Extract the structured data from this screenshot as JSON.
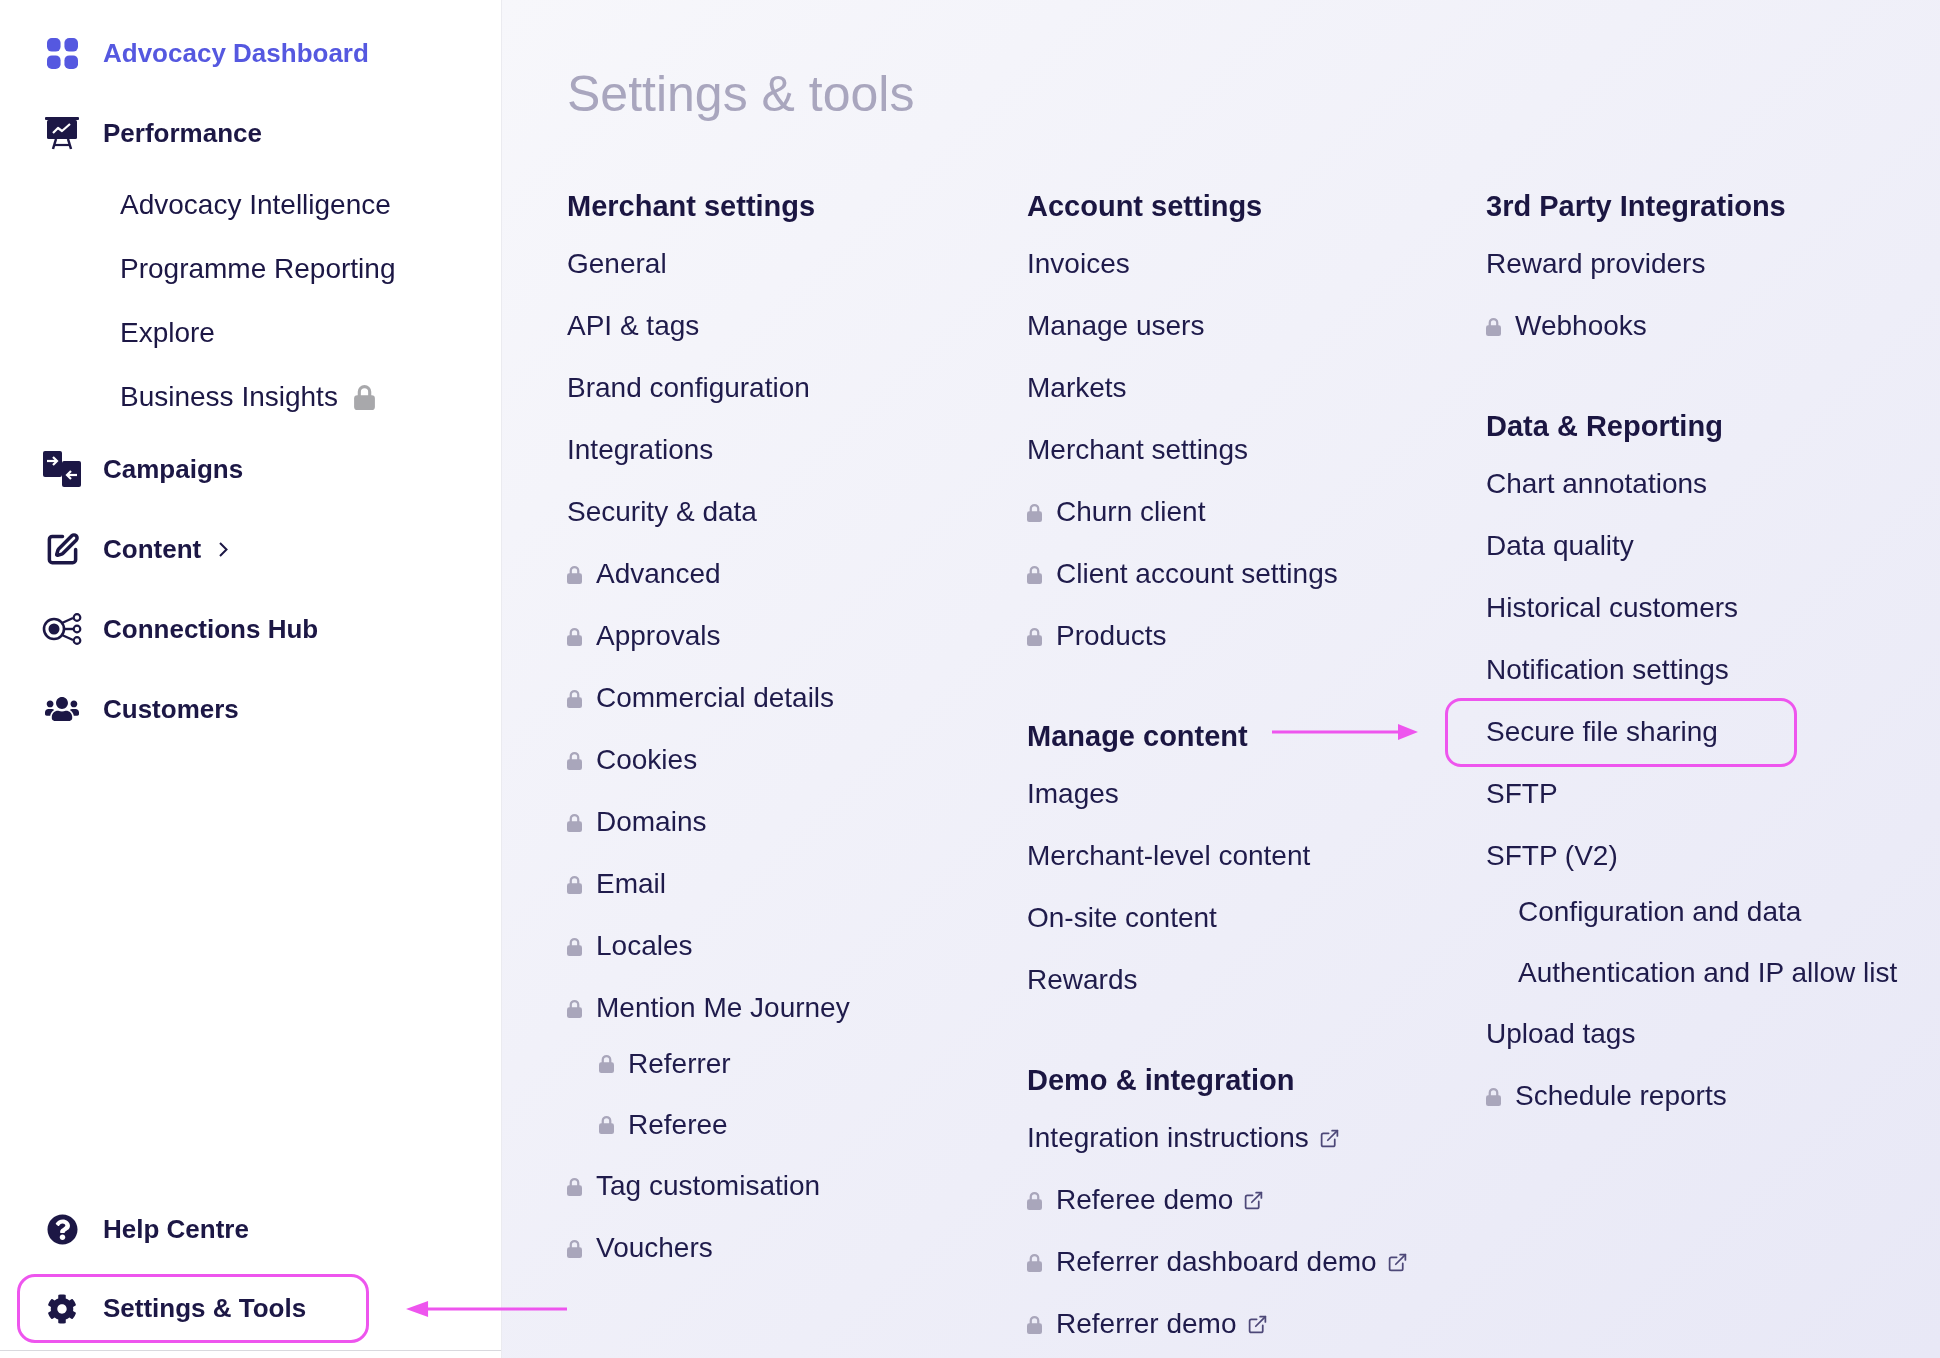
{
  "sidebar": {
    "home": {
      "label": "Advocacy Dashboard"
    },
    "nav": [
      {
        "label": "Performance",
        "expandable": false,
        "children": [
          {
            "label": "Advocacy Intelligence",
            "locked": false
          },
          {
            "label": "Programme Reporting",
            "locked": false
          },
          {
            "label": "Explore",
            "locked": false
          },
          {
            "label": "Business Insights",
            "locked": true
          }
        ]
      },
      {
        "label": "Campaigns",
        "expandable": false
      },
      {
        "label": "Content",
        "expandable": true
      },
      {
        "label": "Connections Hub",
        "expandable": false
      },
      {
        "label": "Customers",
        "expandable": false
      }
    ],
    "footer": [
      {
        "label": "Help Centre",
        "highlighted": false
      },
      {
        "label": "Settings & Tools",
        "highlighted": true
      }
    ]
  },
  "main": {
    "title": "Settings & tools",
    "columns": [
      {
        "sections": [
          {
            "heading": "Merchant settings",
            "items": [
              {
                "label": "General",
                "locked": false
              },
              {
                "label": "API & tags",
                "locked": false
              },
              {
                "label": "Brand configuration",
                "locked": false
              },
              {
                "label": "Integrations",
                "locked": false
              },
              {
                "label": "Security & data",
                "locked": false
              },
              {
                "label": "Advanced",
                "locked": true
              },
              {
                "label": "Approvals",
                "locked": true
              },
              {
                "label": "Commercial details",
                "locked": true
              },
              {
                "label": "Cookies",
                "locked": true
              },
              {
                "label": "Domains",
                "locked": true
              },
              {
                "label": "Email",
                "locked": true
              },
              {
                "label": "Locales",
                "locked": true
              },
              {
                "label": "Mention Me Journey",
                "locked": true,
                "children": [
                  {
                    "label": "Referrer",
                    "locked": true
                  },
                  {
                    "label": "Referee",
                    "locked": true
                  }
                ]
              },
              {
                "label": "Tag customisation",
                "locked": true
              },
              {
                "label": "Vouchers",
                "locked": true
              }
            ]
          }
        ]
      },
      {
        "sections": [
          {
            "heading": "Account settings",
            "items": [
              {
                "label": "Invoices",
                "locked": false
              },
              {
                "label": "Manage users",
                "locked": false
              },
              {
                "label": "Markets",
                "locked": false
              },
              {
                "label": "Merchant settings",
                "locked": false
              },
              {
                "label": "Churn client",
                "locked": true
              },
              {
                "label": "Client account settings",
                "locked": true
              },
              {
                "label": "Products",
                "locked": true
              }
            ]
          },
          {
            "heading": "Manage content",
            "items": [
              {
                "label": "Images",
                "locked": false
              },
              {
                "label": "Merchant-level content",
                "locked": false
              },
              {
                "label": "On-site content",
                "locked": false
              },
              {
                "label": "Rewards",
                "locked": false
              }
            ]
          },
          {
            "heading": "Demo & integration",
            "items": [
              {
                "label": "Integration instructions",
                "locked": false,
                "external": true
              },
              {
                "label": "Referee demo",
                "locked": true,
                "external": true
              },
              {
                "label": "Referrer dashboard demo",
                "locked": true,
                "external": true
              },
              {
                "label": "Referrer demo",
                "locked": true,
                "external": true
              }
            ]
          }
        ]
      },
      {
        "sections": [
          {
            "heading": "3rd Party Integrations",
            "items": [
              {
                "label": "Reward providers",
                "locked": false
              },
              {
                "label": "Webhooks",
                "locked": true
              }
            ]
          },
          {
            "heading": "Data & Reporting",
            "items": [
              {
                "label": "Chart annotations",
                "locked": false,
                "highlighted": false
              },
              {
                "label": "Data quality",
                "locked": false,
                "highlighted": false
              },
              {
                "label": "Historical customers",
                "locked": false,
                "highlighted": false
              },
              {
                "label": "Notification settings",
                "locked": false,
                "highlighted": false
              },
              {
                "label": "Secure file sharing",
                "locked": false,
                "highlighted": true
              },
              {
                "label": "SFTP",
                "locked": false,
                "highlighted": false
              },
              {
                "label": "SFTP (V2)",
                "locked": false,
                "highlighted": false,
                "children": [
                  {
                    "label": "Configuration and data",
                    "locked": false
                  },
                  {
                    "label": "Authentication and IP allow list",
                    "locked": false
                  }
                ]
              },
              {
                "label": "Upload tags",
                "locked": false,
                "highlighted": false
              },
              {
                "label": "Schedule reports",
                "locked": true,
                "highlighted": false
              }
            ]
          }
        ]
      }
    ]
  }
}
